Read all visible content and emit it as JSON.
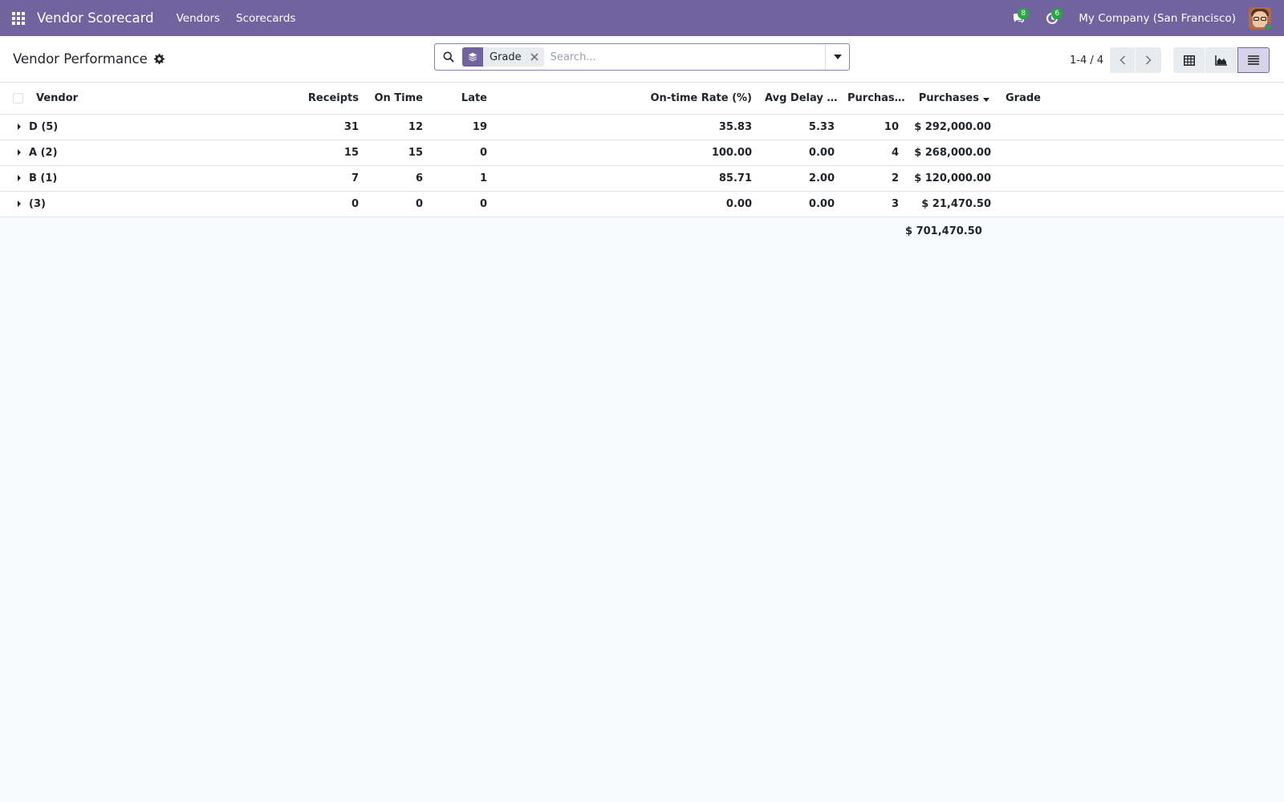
{
  "navbar": {
    "app_name": "Vendor Scorecard",
    "menus": [
      "Vendors",
      "Scorecards"
    ],
    "messages_count": "8",
    "activities_count": "6",
    "company": "My Company (San Francisco)",
    "accent_color": "#71639e"
  },
  "control_panel": {
    "title": "Vendor Performance",
    "search": {
      "facet_label": "Grade",
      "placeholder": "Search..."
    },
    "pager": "1-4 / 4",
    "views": [
      "list-table-icon",
      "area-chart-icon",
      "list-icon"
    ]
  },
  "table": {
    "columns": {
      "vendor": "Vendor",
      "receipts": "Receipts",
      "on_time": "On Time",
      "late": "Late",
      "rate": "On-time Rate (%)",
      "avg_delay": "Avg Delay (...",
      "purchases_count": "Purchas...",
      "purchases": "Purchases",
      "grade": "Grade"
    },
    "groups": [
      {
        "label": "D (5)",
        "receipts": "31",
        "on_time": "12",
        "late": "19",
        "rate": "35.83",
        "avg_delay": "5.33",
        "purchases_count": "10",
        "purchases": "$ 292,000.00"
      },
      {
        "label": "A (2)",
        "receipts": "15",
        "on_time": "15",
        "late": "0",
        "rate": "100.00",
        "avg_delay": "0.00",
        "purchases_count": "4",
        "purchases": "$ 268,000.00"
      },
      {
        "label": "B (1)",
        "receipts": "7",
        "on_time": "6",
        "late": "1",
        "rate": "85.71",
        "avg_delay": "2.00",
        "purchases_count": "2",
        "purchases": "$ 120,000.00"
      },
      {
        "label": "(3)",
        "receipts": "0",
        "on_time": "0",
        "late": "0",
        "rate": "0.00",
        "avg_delay": "0.00",
        "purchases_count": "3",
        "purchases": "$ 21,470.50"
      }
    ],
    "total_purchases": "$ 701,470.50"
  }
}
